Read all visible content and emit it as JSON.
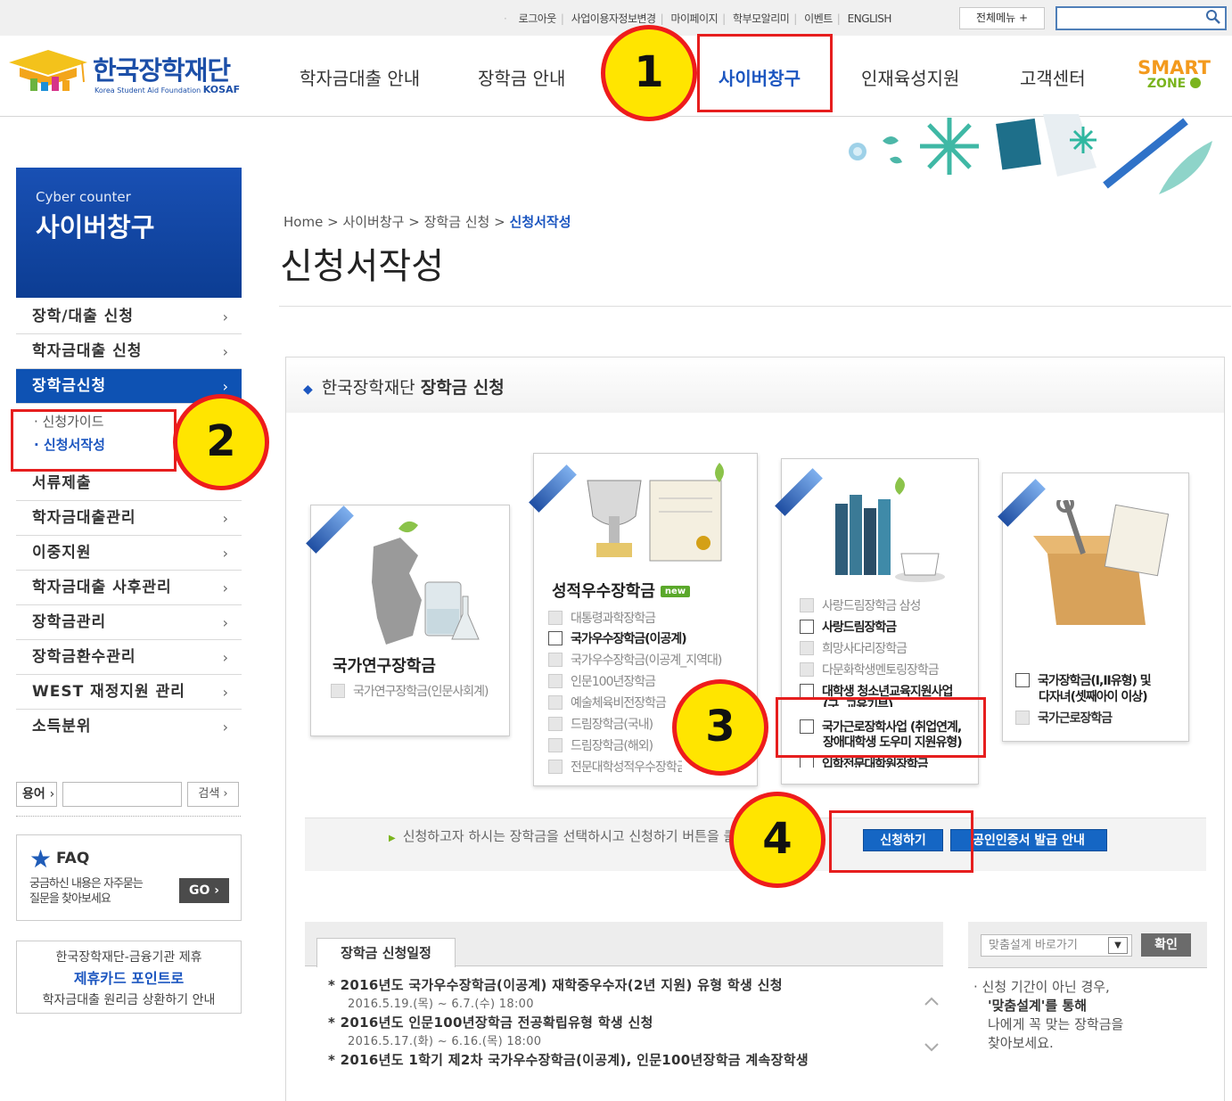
{
  "utility": {
    "links": [
      "로그아웃",
      "사업이용자정보변경",
      "마이페이지",
      "학부모알리미",
      "이벤트",
      "ENGLISH"
    ],
    "all_menu": "전체메뉴 +",
    "search_placeholder": ""
  },
  "logo": {
    "ko": "한국장학재단",
    "en": "Korea Student Aid Foundation",
    "abbr": "KOSAF"
  },
  "gnb": [
    "학자금대출 안내",
    "장학금 안내",
    "사이버창구",
    "인재육성지원",
    "고객센터"
  ],
  "smart": {
    "line1": "SMART",
    "line2": "ZONE"
  },
  "badges": [
    "1",
    "2",
    "3",
    "4"
  ],
  "lnb": {
    "head_en": "Cyber counter",
    "head_ko": "사이버창구",
    "items": [
      "장학/대출 신청",
      "학자금대출 신청",
      "장학금신청",
      "서류제출",
      "학자금대출관리",
      "이중지원",
      "학자금대출 사후관리",
      "장학금관리",
      "장학금환수관리",
      "WEST 재정지원 관리",
      "소득분위"
    ],
    "sub": [
      "· 신청가이드",
      "· 신청서작성"
    ],
    "chevron": "›"
  },
  "term": {
    "label": "용어",
    "search": "검색"
  },
  "faq": {
    "title": "FAQ",
    "desc1": "궁금하신 내용은 자주묻는",
    "desc2": "질문을 찾아보세요",
    "go": "GO"
  },
  "card": {
    "line1": "한국장학재단-금융기관 제휴",
    "line2": "제휴카드 포인트로",
    "line3": "학자금대출 원리금 상환하기 안내"
  },
  "breadcrumb": {
    "home": "Home",
    "l1": "사이버창구",
    "l2": "장학금 신청",
    "current": "신청서작성",
    "sep": ">"
  },
  "page_title": "신청서작성",
  "panel": {
    "title_prefix": "한국장학재단",
    "title_bold": "장학금 신청"
  },
  "scholarships": {
    "research": {
      "title": "국가연구장학금",
      "options": [
        {
          "label": "국가연구장학금(인문사회계)",
          "enabled": false
        }
      ]
    },
    "merit": {
      "title": "성적우수장학금",
      "new": "new",
      "options": [
        {
          "label": "대통령과학장학금",
          "enabled": false
        },
        {
          "label": "국가우수장학금(이공계)",
          "enabled": true
        },
        {
          "label": "국가우수장학금(이공계_지역대)",
          "enabled": false
        },
        {
          "label": "인문100년장학금",
          "enabled": false
        },
        {
          "label": "예술체육비전장학금",
          "enabled": false
        },
        {
          "label": "드림장학금(국내)",
          "enabled": false
        },
        {
          "label": "드림장학금(해외)",
          "enabled": false
        },
        {
          "label": "전문대학성적우수장학금",
          "enabled": false
        }
      ]
    },
    "dream": {
      "options": [
        {
          "label": "사랑드림장학금 삼성",
          "enabled": false
        },
        {
          "label": "사랑드림장학금",
          "enabled": true
        },
        {
          "label": "희망사다리장학금",
          "enabled": false
        },
        {
          "label": "다문화학생멘토링장학금",
          "enabled": false
        },
        {
          "label": "대학생 청소년교육지원사업",
          "enabled": true
        },
        {
          "label": "(구, 교육기부)",
          "enabled": true
        },
        {
          "label": "국가근로장학사업 (취업연계,",
          "enabled": true
        },
        {
          "label": "장애대학생 도우미 지원유형)",
          "enabled": true
        },
        {
          "label": "입학전문대학원장학금",
          "enabled": true
        }
      ]
    },
    "national": {
      "options": [
        {
          "label": "국가장학금(I,II유형) 및",
          "enabled": true
        },
        {
          "label": "다자녀(셋째아이 이상)",
          "enabled": true
        },
        {
          "label": "국가근로장학금",
          "enabled": false
        }
      ]
    }
  },
  "apply": {
    "note": "신청하고자 하시는 장학금을 선택하시고 신청하기 버튼을 클릭해 주세요.",
    "apply_btn": "신청하기",
    "cert_btn": "공인인증서 발급 안내"
  },
  "schedule": {
    "tab": "장학금 신청일정",
    "items": [
      {
        "title": "* 2016년도 국가우수장학금(이공계) 재학중우수자(2년 지원) 유형 학생 신청",
        "date": "2016.5.19.(목) ~ 6.7.(수) 18:00"
      },
      {
        "title": "* 2016년도 인문100년장학금 전공확립유형 학생 신청",
        "date": "2016.5.17.(화) ~ 6.16.(목) 18:00"
      },
      {
        "title": "* 2016년도 1학기 제2차 국가우수장학금(이공계), 인문100년장학금 계속장학생",
        "date": ""
      }
    ]
  },
  "custom": {
    "select": "맞춤설계 바로가기",
    "ok": "확인",
    "line1": "· 신청 기간이 아닌 경우,",
    "line2": "'맞춤설계'를 통해",
    "line3": "나에게 꼭 맞는 장학금을",
    "line4": "찾아보세요."
  },
  "colors": {
    "brand": "#1c4fa8",
    "highlight": "#e61e1e",
    "badge": "#ffe500",
    "button": "#1566c4"
  }
}
